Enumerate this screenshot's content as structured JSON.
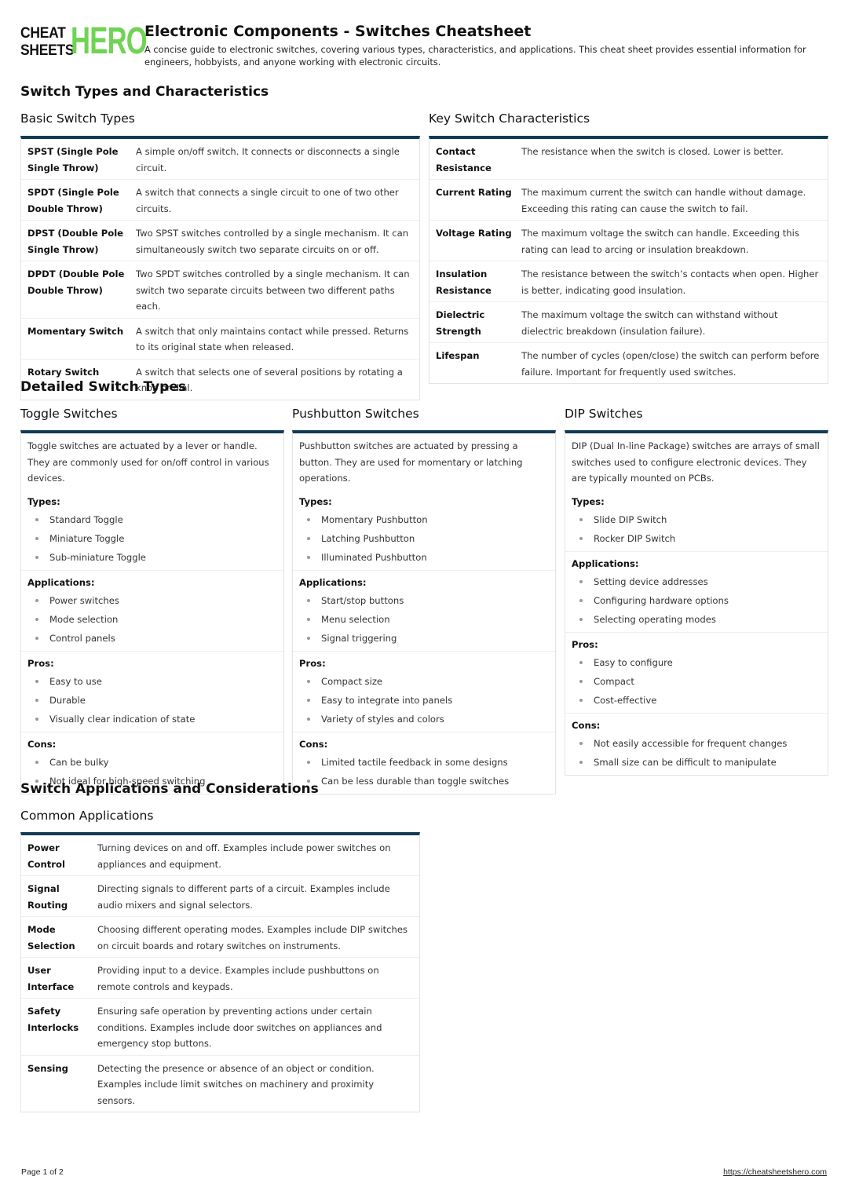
{
  "brand": {
    "logo_top": "CHEAT",
    "logo_bottom": "SHEETS",
    "logo_hero": "HERO",
    "accent_color": "#6fd353",
    "bar_color": "#0f3b55"
  },
  "header": {
    "title": "Electronic Components - Switches Cheatsheet",
    "subtitle": "A concise guide to electronic switches, covering various types, characteristics, and applications. This cheat sheet provides essential information for engineers, hobbyists, and anyone working with electronic circuits."
  },
  "sections": {
    "types_chars": "Switch Types and Characteristics",
    "detailed": "Detailed Switch Types",
    "applications": "Switch Applications and Considerations"
  },
  "basic_types": {
    "title": "Basic Switch Types",
    "rows": [
      {
        "k": "SPST (Single Pole Single Throw)",
        "v": "A simple on/off switch. It connects or disconnects a single circuit."
      },
      {
        "k": "SPDT (Single Pole Double Throw)",
        "v": "A switch that connects a single circuit to one of two other circuits."
      },
      {
        "k": "DPST (Double Pole Single Throw)",
        "v": "Two SPST switches controlled by a single mechanism. It can simultaneously switch two separate circuits on or off."
      },
      {
        "k": "DPDT (Double Pole Double Throw)",
        "v": "Two SPDT switches controlled by a single mechanism. It can switch two separate circuits between two different paths each."
      },
      {
        "k": "Momentary Switch",
        "v": "A switch that only maintains contact while pressed. Returns to its original state when released."
      },
      {
        "k": "Rotary Switch",
        "v": "A switch that selects one of several positions by rotating a knob or dial."
      }
    ]
  },
  "key_chars": {
    "title": "Key Switch Characteristics",
    "rows": [
      {
        "k": "Contact Resistance",
        "v": "The resistance when the switch is closed. Lower is better."
      },
      {
        "k": "Current Rating",
        "v": "The maximum current the switch can handle without damage. Exceeding this rating can cause the switch to fail."
      },
      {
        "k": "Voltage Rating",
        "v": "The maximum voltage the switch can handle. Exceeding this rating can lead to arcing or insulation breakdown."
      },
      {
        "k": "Insulation Resistance",
        "v": "The resistance between the switch’s contacts when open. Higher is better, indicating good insulation."
      },
      {
        "k": "Dielectric Strength",
        "v": "The maximum voltage the switch can withstand without dielectric breakdown (insulation failure)."
      },
      {
        "k": "Lifespan",
        "v": "The number of cycles (open/close) the switch can perform before failure. Important for frequently used switches."
      }
    ]
  },
  "detailed": [
    {
      "title": "Toggle Switches",
      "intro": "Toggle switches are actuated by a lever or handle. They are commonly used for on/off control in various devices.",
      "groups": [
        {
          "label": "Types:",
          "items": [
            "Standard Toggle",
            "Miniature Toggle",
            "Sub-miniature Toggle"
          ]
        },
        {
          "label": "Applications:",
          "items": [
            "Power switches",
            "Mode selection",
            "Control panels"
          ]
        },
        {
          "label": "Pros:",
          "items": [
            "Easy to use",
            "Durable",
            "Visually clear indication of state"
          ]
        },
        {
          "label": "Cons:",
          "items": [
            "Can be bulky",
            "Not ideal for high-speed switching"
          ]
        }
      ]
    },
    {
      "title": "Pushbutton Switches",
      "intro": "Pushbutton switches are actuated by pressing a button. They are used for momentary or latching operations.",
      "groups": [
        {
          "label": "Types:",
          "items": [
            "Momentary Pushbutton",
            "Latching Pushbutton",
            "Illuminated Pushbutton"
          ]
        },
        {
          "label": "Applications:",
          "items": [
            "Start/stop buttons",
            "Menu selection",
            "Signal triggering"
          ]
        },
        {
          "label": "Pros:",
          "items": [
            "Compact size",
            "Easy to integrate into panels",
            "Variety of styles and colors"
          ]
        },
        {
          "label": "Cons:",
          "items": [
            "Limited tactile feedback in some designs",
            "Can be less durable than toggle switches"
          ]
        }
      ]
    },
    {
      "title": "DIP Switches",
      "intro": "DIP (Dual In-line Package) switches are arrays of small switches used to configure electronic devices. They are typically mounted on PCBs.",
      "groups": [
        {
          "label": "Types:",
          "items": [
            "Slide DIP Switch",
            "Rocker DIP Switch"
          ]
        },
        {
          "label": "Applications:",
          "items": [
            "Setting device addresses",
            "Configuring hardware options",
            "Selecting operating modes"
          ]
        },
        {
          "label": "Pros:",
          "items": [
            "Easy to configure",
            "Compact",
            "Cost-effective"
          ]
        },
        {
          "label": "Cons:",
          "items": [
            "Not easily accessible for frequent changes",
            "Small size can be difficult to manipulate"
          ]
        }
      ]
    }
  ],
  "common_apps": {
    "title": "Common Applications",
    "rows": [
      {
        "k": "Power Control",
        "v": "Turning devices on and off. Examples include power switches on appliances and equipment."
      },
      {
        "k": "Signal Routing",
        "v": "Directing signals to different parts of a circuit. Examples include audio mixers and signal selectors."
      },
      {
        "k": "Mode Selection",
        "v": "Choosing different operating modes. Examples include DIP switches on circuit boards and rotary switches on instruments."
      },
      {
        "k": "User Interface",
        "v": "Providing input to a device. Examples include pushbuttons on remote controls and keypads."
      },
      {
        "k": "Safety Interlocks",
        "v": "Ensuring safe operation by preventing actions under certain conditions. Examples include door switches on appliances and emergency stop buttons."
      },
      {
        "k": "Sensing",
        "v": "Detecting the presence or absence of an object or condition. Examples include limit switches on machinery and proximity sensors."
      }
    ]
  },
  "footer": {
    "page": "Page 1 of 2",
    "url": "https://cheatsheetshero.com"
  }
}
